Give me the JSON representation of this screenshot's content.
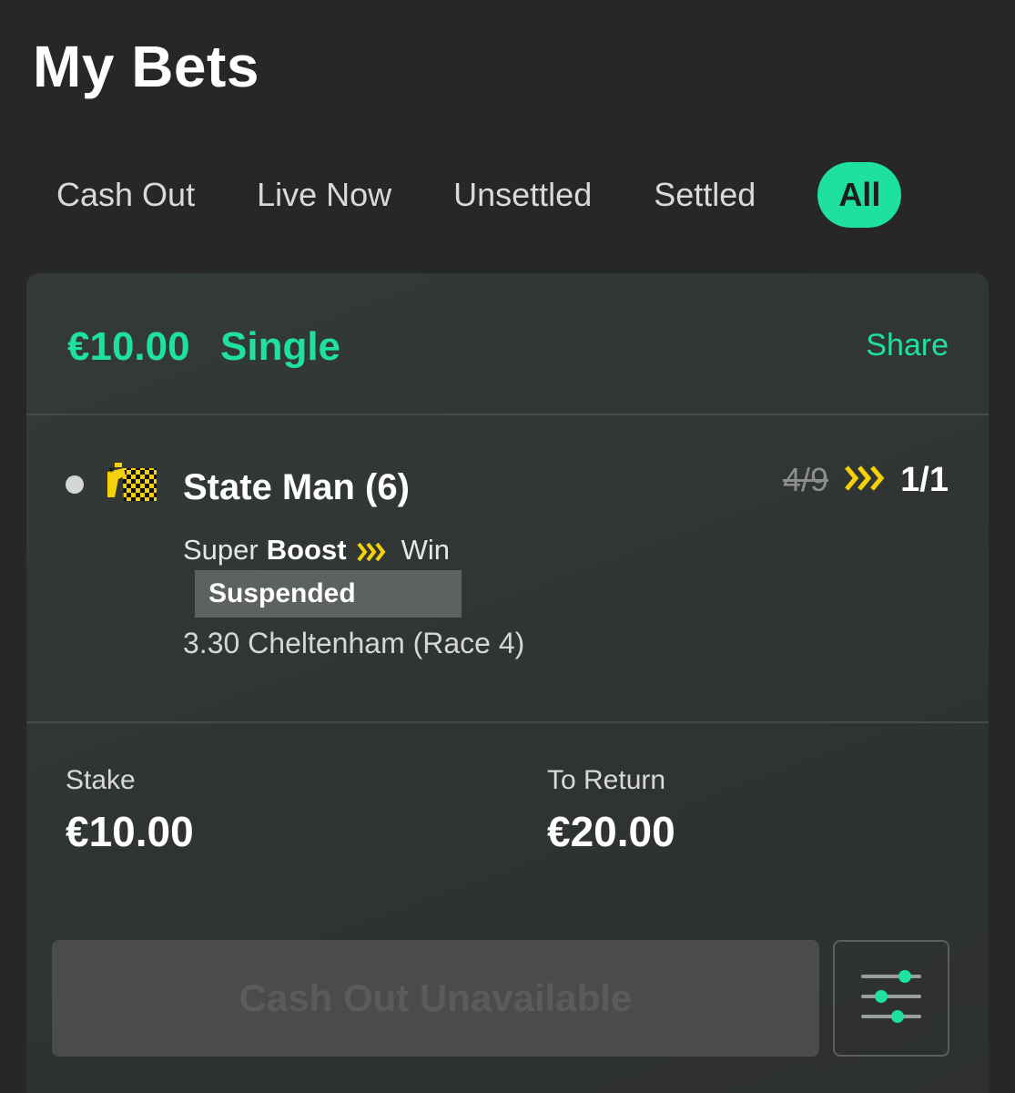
{
  "header": {
    "title": "My Bets"
  },
  "tabs": [
    {
      "label": "Cash Out",
      "active": false
    },
    {
      "label": "Live Now",
      "active": false
    },
    {
      "label": "Unsettled",
      "active": false
    },
    {
      "label": "Settled",
      "active": false
    },
    {
      "label": "All",
      "active": true
    }
  ],
  "bet": {
    "amount": "€10.00",
    "type": "Single",
    "share_label": "Share",
    "selection": {
      "runner": "State Man (6)",
      "odds_old": "4/9",
      "odds_new": "1/1",
      "market_prefix": "Super",
      "market_boost": "Boost",
      "market_type": "Win",
      "status": "Suspended",
      "event": "3.30 Cheltenham (Race 4)"
    },
    "stake_label": "Stake",
    "stake_value": "€10.00",
    "return_label": "To Return",
    "return_value": "€20.00",
    "cashout_label": "Cash Out Unavailable"
  },
  "icons": {
    "silks": "jockey-silks-icon",
    "boost": "boost-chevrons-icon",
    "settings": "sliders-icon"
  },
  "colors": {
    "accent": "#1ee0a1",
    "boost": "#f5d10a",
    "background": "#272727",
    "card": "#313634"
  }
}
